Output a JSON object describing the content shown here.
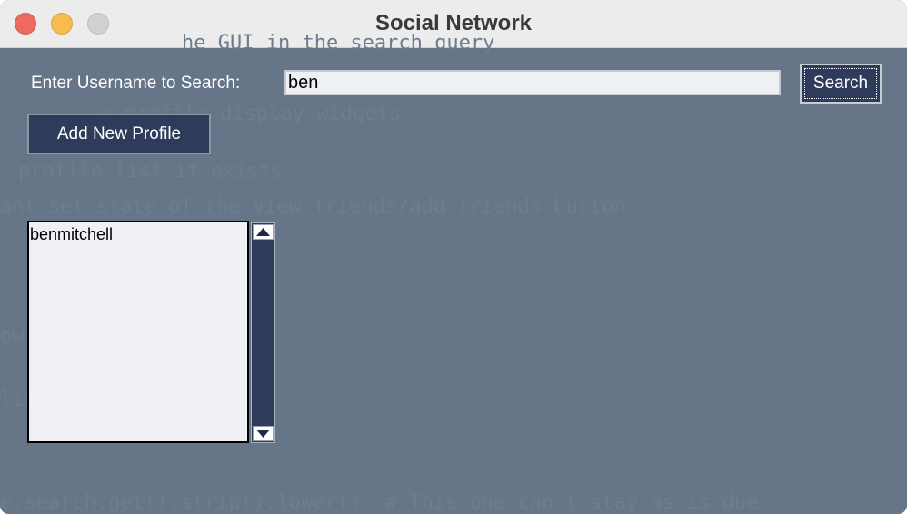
{
  "window": {
    "title": "Social Network"
  },
  "search": {
    "label": "Enter Username to Search:",
    "value": "ben",
    "button_label": "Search"
  },
  "actions": {
    "add_profile_label": "Add New Profile"
  },
  "results": {
    "items": [
      "benmitchell"
    ]
  },
  "background_code": [
    "he GUI in the search query",
    "e profile display widgets",
    "profile list if exists",
    "ant set state of the view friends/add friends button",
    "ow()",
    "list)",
    "e.search.get().strip().lower()  # This one can't stay as is due"
  ],
  "colors": {
    "window_bg": "#677589",
    "titlebar_bg": "#ececec",
    "button_bg": "#2f3b5a",
    "input_bg": "#eef0f3",
    "close": "#ee6a5f",
    "minimize": "#f5bd4f",
    "zoom": "#d1d1d1"
  }
}
